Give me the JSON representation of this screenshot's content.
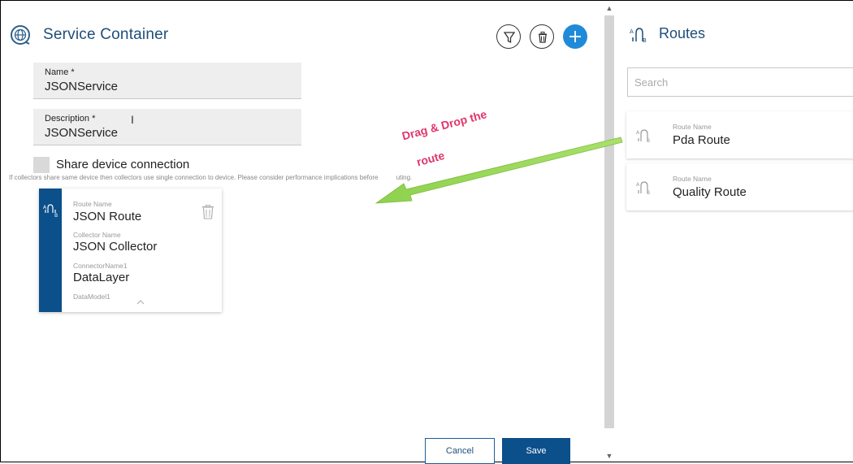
{
  "left_panel": {
    "title": "Service Container",
    "fields": {
      "name": {
        "label": "Name *",
        "value": "JSONService"
      },
      "description": {
        "label": "Description *",
        "value": "JSONService"
      }
    },
    "share": {
      "label": "Share device connection",
      "note": "If collectors share same device then collectors use single connection to device. Please consider performance implications before",
      "note_tail": "uting."
    },
    "route_card": {
      "route_name_label": "Route Name",
      "route_name": "JSON Route",
      "collector_label": "Collector Name",
      "collector": "JSON Collector",
      "connector_label": "ConnectorName1",
      "connector": "DataLayer",
      "datamodel_label": "DataModel1"
    },
    "buttons": {
      "cancel": "Cancel",
      "save": "Save"
    },
    "icons": [
      "globe-icon",
      "filter-icon",
      "trash-icon",
      "plus-icon"
    ]
  },
  "annotation": {
    "line1": "Drag & Drop the",
    "line2": "route",
    "color": "#e0366b",
    "arrow_color": "#8fd14f"
  },
  "right_panel": {
    "title": "Routes",
    "search_placeholder": "Search",
    "routes": [
      {
        "label": "Route Name",
        "name": "Pda Route"
      },
      {
        "label": "Route Name",
        "name": "Quality Route"
      }
    ]
  },
  "colors": {
    "accent": "#1f8ad8",
    "primary": "#0b4f8b",
    "title": "#1f4e79"
  }
}
